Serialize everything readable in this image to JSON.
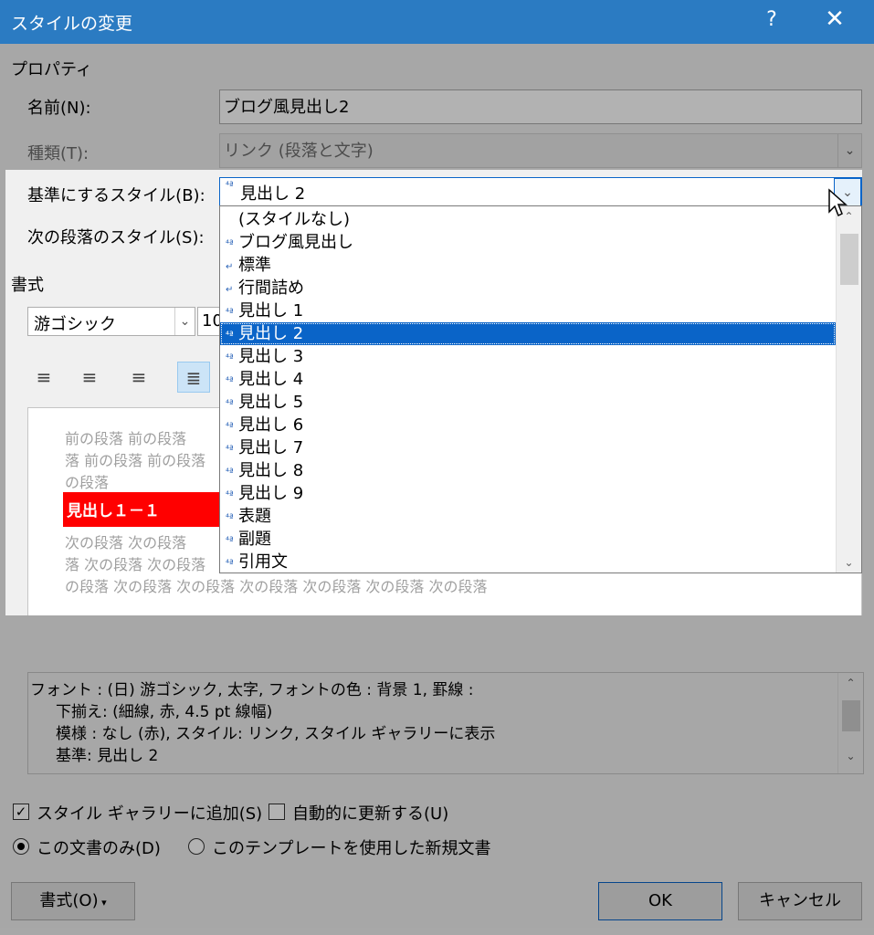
{
  "window": {
    "title": "スタイルの変更",
    "help_label": "?",
    "close_label": "✕"
  },
  "properties": {
    "section_label": "プロパティ",
    "name_label": "名前(N):",
    "name_value": "ブログ風見出し2",
    "type_label": "種類(T):",
    "type_value": "リンク (段落と文字)",
    "base_label": "基準にするスタイル(B):",
    "base_value": "見出し 2",
    "next_label": "次の段落のスタイル(S):"
  },
  "format": {
    "section_label": "書式",
    "font_value": "游ゴシック",
    "size_value": "10"
  },
  "dropdown": {
    "items": [
      {
        "label": "(スタイルなし)",
        "icon": "none"
      },
      {
        "label": "ブログ風見出し",
        "icon": "linked-style-icon"
      },
      {
        "label": "標準",
        "icon": "paragraph-style-icon"
      },
      {
        "label": "行間詰め",
        "icon": "paragraph-style-icon"
      },
      {
        "label": "見出し 1",
        "icon": "linked-style-icon"
      },
      {
        "label": "見出し 2",
        "icon": "linked-style-icon",
        "selected": true
      },
      {
        "label": "見出し 3",
        "icon": "linked-style-icon"
      },
      {
        "label": "見出し 4",
        "icon": "linked-style-icon"
      },
      {
        "label": "見出し 5",
        "icon": "linked-style-icon"
      },
      {
        "label": "見出し 6",
        "icon": "linked-style-icon"
      },
      {
        "label": "見出し 7",
        "icon": "linked-style-icon"
      },
      {
        "label": "見出し 8",
        "icon": "linked-style-icon"
      },
      {
        "label": "見出し 9",
        "icon": "linked-style-icon"
      },
      {
        "label": "表題",
        "icon": "linked-style-icon"
      },
      {
        "label": "副題",
        "icon": "linked-style-icon"
      },
      {
        "label": "引用文",
        "icon": "linked-style-icon"
      }
    ]
  },
  "preview": {
    "prev_line1": "前の段落 前の段落",
    "prev_line2": "落 前の段落 前の段落",
    "prev_line3": "の段落",
    "heading_text": "見出し１－１",
    "heading_bg": "#ff0000",
    "next_line1": "次の段落 次の段落",
    "next_line2": "落 次の段落 次の段落",
    "next_line3": "の段落 次の段落 次の段落 次の段落 次の段落 次の段落 次の段落"
  },
  "description": {
    "line1": "フォント : (日) 游ゴシック, 太字, フォントの色 : 背景 1, 罫線 :",
    "line2": "下揃え: (細線, 赤,  4.5 pt 線幅)",
    "line3": "模様 : なし (赤), スタイル: リンク, スタイル ギャラリーに表示",
    "line4": "基準: 見出し 2"
  },
  "options": {
    "add_gallery_label": "スタイル ギャラリーに追加(S)",
    "add_gallery_checked": true,
    "auto_update_label": "自動的に更新する(U)",
    "auto_update_checked": false,
    "this_doc_label": "この文書のみ(D)",
    "template_label": "このテンプレートを使用した新規文書"
  },
  "buttons": {
    "format_label": "書式(O)",
    "ok_label": "OK",
    "cancel_label": "キャンセル"
  },
  "colors": {
    "titlebar": "#2b7bc2",
    "selection": "#0a64c8",
    "heading_red": "#ff0000"
  }
}
